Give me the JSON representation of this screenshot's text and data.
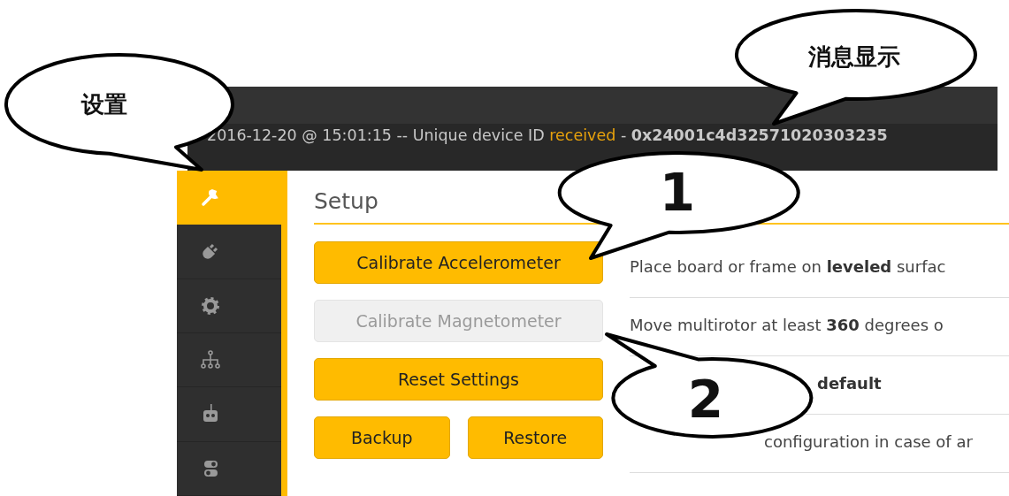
{
  "callouts": [
    {
      "text": "设置"
    },
    {
      "text": "消息显示"
    },
    {
      "text": "1"
    },
    {
      "text": "2"
    }
  ],
  "log": {
    "parts": [
      {
        "kind": "plain",
        "text": "2016-12-20 @ 15:01:15 -- Unique device ID"
      },
      {
        "kind": "highlight",
        "text": "received"
      },
      {
        "kind": "plain",
        "text": "-"
      },
      {
        "kind": "bold",
        "text": "0x24001c4d32571020303235"
      }
    ]
  },
  "sidebar": {
    "items": [
      {
        "selected": true
      },
      {
        "selected": false
      },
      {
        "selected": false
      },
      {
        "selected": false
      },
      {
        "selected": false
      },
      {
        "selected": false
      }
    ]
  },
  "page_title": "Setup",
  "rows": [
    {
      "buttons": [
        {
          "label": "Calibrate Accelerometer",
          "disabled": false
        }
      ],
      "description": "Place board or frame on **leveled** surfac"
    },
    {
      "buttons": [
        {
          "label": "Calibrate Magnetometer",
          "disabled": true
        }
      ],
      "description": "Move multirotor at least **360** degrees o"
    },
    {
      "buttons": [
        {
          "label": "Reset Settings",
          "disabled": false
        }
      ],
      "description": "**default**"
    },
    {
      "buttons": [
        {
          "label": "Backup",
          "disabled": false
        },
        {
          "label": "Restore",
          "disabled": false
        }
      ],
      "description": "configuration in case of ar"
    }
  ]
}
